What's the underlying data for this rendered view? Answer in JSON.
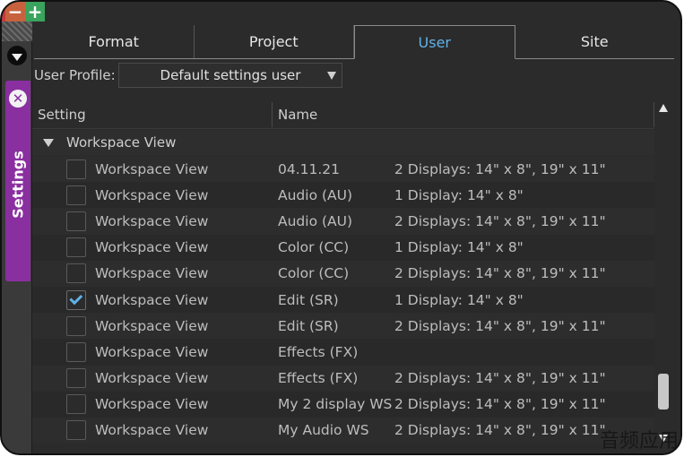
{
  "window": {
    "minimize_symbol": "−",
    "maximize_symbol": "+"
  },
  "sidebar": {
    "tab_label": "Settings",
    "close_symbol": "✕"
  },
  "tabs": [
    {
      "label": "Format",
      "active": false
    },
    {
      "label": "Project",
      "active": false
    },
    {
      "label": "User",
      "active": true
    },
    {
      "label": "Site",
      "active": false
    }
  ],
  "profile": {
    "label": "User Profile:",
    "selected": "Default settings user"
  },
  "table": {
    "headers": {
      "setting": "Setting",
      "name": "Name"
    },
    "group_label": "Workspace View",
    "rows": [
      {
        "setting": "Workspace View",
        "name": "04.11.21",
        "desc": "2 Displays: 14\" x 8\", 19\" x 11\"",
        "checked": false
      },
      {
        "setting": "Workspace View",
        "name": "Audio (AU)",
        "desc": "1 Display: 14\" x 8\"",
        "checked": false
      },
      {
        "setting": "Workspace View",
        "name": "Audio (AU)",
        "desc": "2 Displays: 14\" x 8\", 19\" x 11\"",
        "checked": false
      },
      {
        "setting": "Workspace View",
        "name": "Color (CC)",
        "desc": "1 Display: 14\" x 8\"",
        "checked": false
      },
      {
        "setting": "Workspace View",
        "name": "Color (CC)",
        "desc": "2 Displays: 14\" x 8\", 19\" x 11\"",
        "checked": false
      },
      {
        "setting": "Workspace View",
        "name": "Edit (SR)",
        "desc": "1 Display: 14\" x 8\"",
        "checked": true
      },
      {
        "setting": "Workspace View",
        "name": "Edit (SR)",
        "desc": "2 Displays: 14\" x 8\", 19\" x 11\"",
        "checked": false
      },
      {
        "setting": "Workspace View",
        "name": "Effects (FX)",
        "desc": "",
        "checked": false
      },
      {
        "setting": "Workspace View",
        "name": "Effects (FX)",
        "desc": "2 Displays: 14\" x 8\", 19\" x 11\"",
        "checked": false
      },
      {
        "setting": "Workspace View",
        "name": "My 2 display WS",
        "desc": "2 Displays: 14\" x 8\", 19\" x 11\"",
        "checked": false
      },
      {
        "setting": "Workspace View",
        "name": "My Audio WS",
        "desc": "2 Displays: 14\" x 8\", 19\" x 11\"",
        "checked": false
      }
    ]
  },
  "scrollbar": {
    "position": 0.92
  },
  "watermark": "音频应用"
}
